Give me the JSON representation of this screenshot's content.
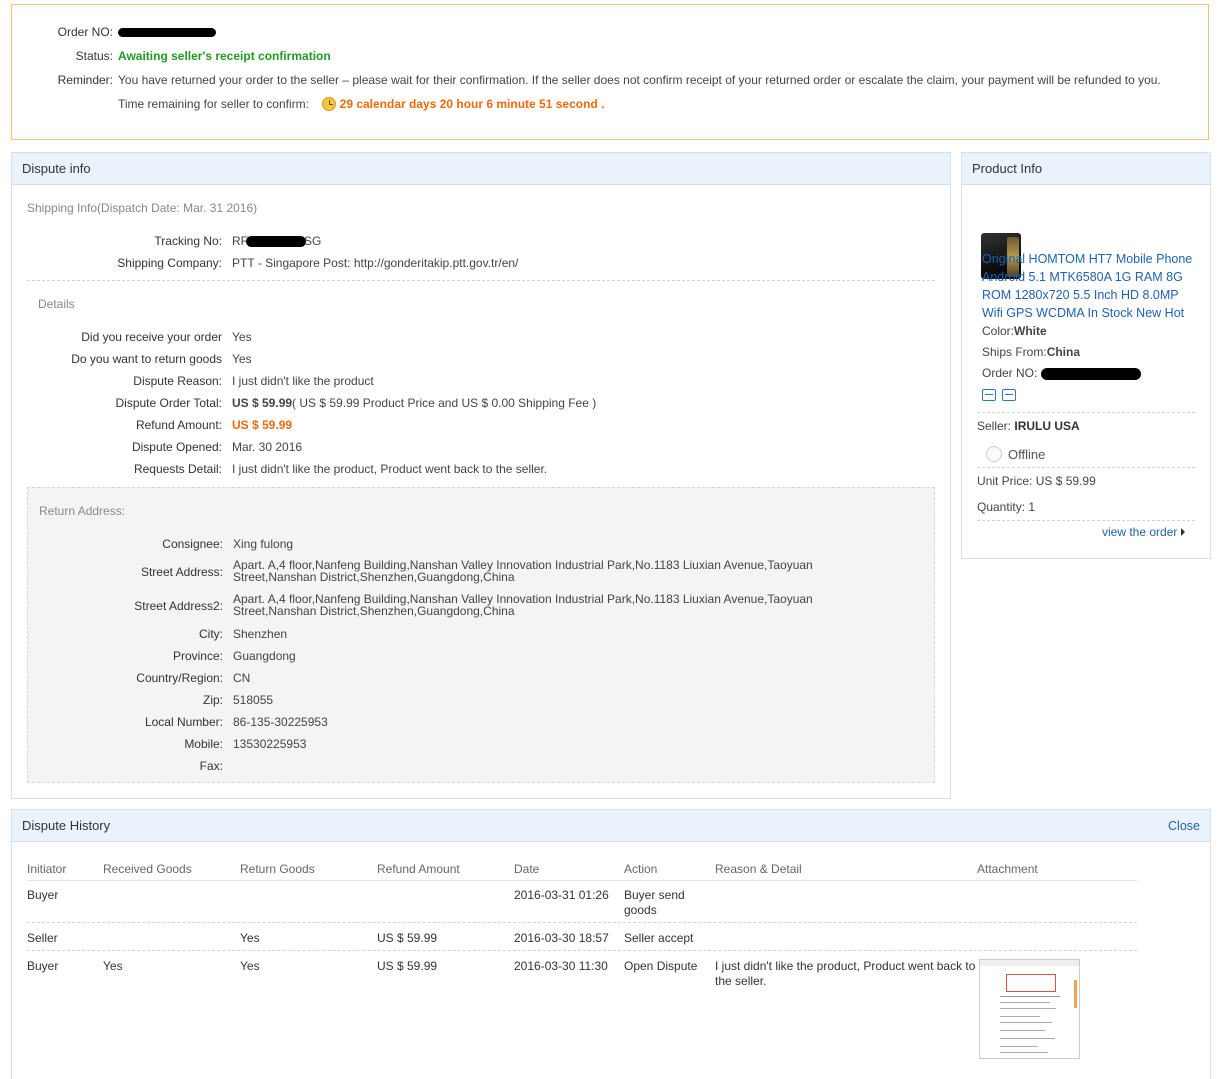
{
  "status": {
    "order_label": "Order NO:",
    "status_label": "Status:",
    "status_value": "Awaiting seller's receipt confirmation",
    "reminder_label": "Reminder:",
    "reminder_text": "You have returned your order to the seller – please wait for their confirmation. If the seller does not confirm receipt of your returned order or escalate the claim, your payment will be refunded to you.",
    "time_label": "Time remaining for seller to confirm:",
    "time_value": "29 calendar days 20 hour 6 minute 51 second",
    "time_suffix": "."
  },
  "dispute_info": {
    "title": "Dispute info",
    "shipping_title": "Shipping Info(Dispatch Date: Mar. 31 2016)",
    "tracking_label": "Tracking No:",
    "tracking_prefix": "RF",
    "tracking_suffix": "SG",
    "company_label": "Shipping Company:",
    "company_value": "PTT - Singapore Post: http://gonderitakip.ptt.gov.tr/en/",
    "details_title": "Details",
    "details": [
      {
        "label": "Did you receive your order",
        "value": "Yes"
      },
      {
        "label": "Do you want to return goods",
        "value": "Yes"
      },
      {
        "label": "Dispute Reason:",
        "value": "I just didn't like the product"
      },
      {
        "label": "Dispute Order Total:",
        "value_bold": "US $ 59.99",
        "value": "( US $ 59.99 Product Price and US $ 0.00 Shipping Fee )"
      },
      {
        "label": "Refund Amount:",
        "value_orange": "US $ 59.99"
      },
      {
        "label": "Dispute Opened:",
        "value": "Mar. 30 2016"
      },
      {
        "label": "Requests Detail:",
        "value": "I just didn't like the product, Product went back to the seller."
      }
    ],
    "return_title": "Return Address:",
    "return": [
      {
        "label": "Consignee:",
        "value": "Xing fulong"
      },
      {
        "label": "Street Address:",
        "line1": "Apart. A,4 floor,Nanfeng Building,Nanshan Valley Innovation Industrial Park,No.1183 Liuxian Avenue,Taoyuan",
        "line2": "Street,Nanshan District,Shenzhen,Guangdong,China"
      },
      {
        "label": "Street Address2:",
        "line1": "Apart. A,4 floor,Nanfeng Building,Nanshan Valley Innovation Industrial Park,No.1183 Liuxian Avenue,Taoyuan",
        "line2": "Street,Nanshan District,Shenzhen,Guangdong,China"
      },
      {
        "label": "City:",
        "value": "Shenzhen"
      },
      {
        "label": "Province:",
        "value": "Guangdong"
      },
      {
        "label": "Country/Region:",
        "value": "CN"
      },
      {
        "label": "Zip:",
        "value": "518055"
      },
      {
        "label": "Local Number:",
        "value": "86-135-30225953"
      },
      {
        "label": "Mobile:",
        "value": "13530225953"
      },
      {
        "label": "Fax:",
        "value": ""
      }
    ]
  },
  "product_info": {
    "title": "Product Info",
    "product_lines": [
      "Original HOMTOM HT7 Mobile Phone",
      "Android 5.1 MTK6580A 1G RAM 8G",
      "ROM 1280x720 5.5 Inch HD 8.0MP",
      "Wifi GPS WCDMA In Stock New Hot"
    ],
    "color_label": "Color:",
    "color_value": "White",
    "ships_label": "Ships From:",
    "ships_value": "China",
    "order_label": "Order NO:",
    "seller_label": "Seller:",
    "seller_value": "IRULU USA",
    "online_status": "Offline",
    "unit_price_label": "Unit Price:",
    "unit_price_value": "US $ 59.99",
    "quantity_label": "Quantity:",
    "quantity_value": "1",
    "view_order": "view the order"
  },
  "history": {
    "title": "Dispute History",
    "close_label": "Close",
    "columns": [
      "Initiator",
      "Received Goods",
      "Return Goods",
      "Refund Amount",
      "Date",
      "Action",
      "Reason & Detail",
      "Attachment"
    ],
    "rows": [
      {
        "initiator": "Buyer",
        "received": "",
        "returned": "",
        "refund": "",
        "date": "2016-03-31 01:26",
        "action1": "Buyer send",
        "action2": "goods",
        "reason1": "",
        "reason2": ""
      },
      {
        "initiator": "Seller",
        "received": "",
        "returned": "Yes",
        "refund": "US $ 59.99",
        "date": "2016-03-30 18:57",
        "action1": "Seller accept",
        "action2": "",
        "reason1": "",
        "reason2": ""
      },
      {
        "initiator": "Buyer",
        "received": "Yes",
        "returned": "Yes",
        "refund": "US $ 59.99",
        "date": "2016-03-30 11:30",
        "action1": "Open Dispute",
        "action2": "",
        "reason1": "I just didn't like the product, Product went back to",
        "reason2": "the seller."
      }
    ]
  }
}
